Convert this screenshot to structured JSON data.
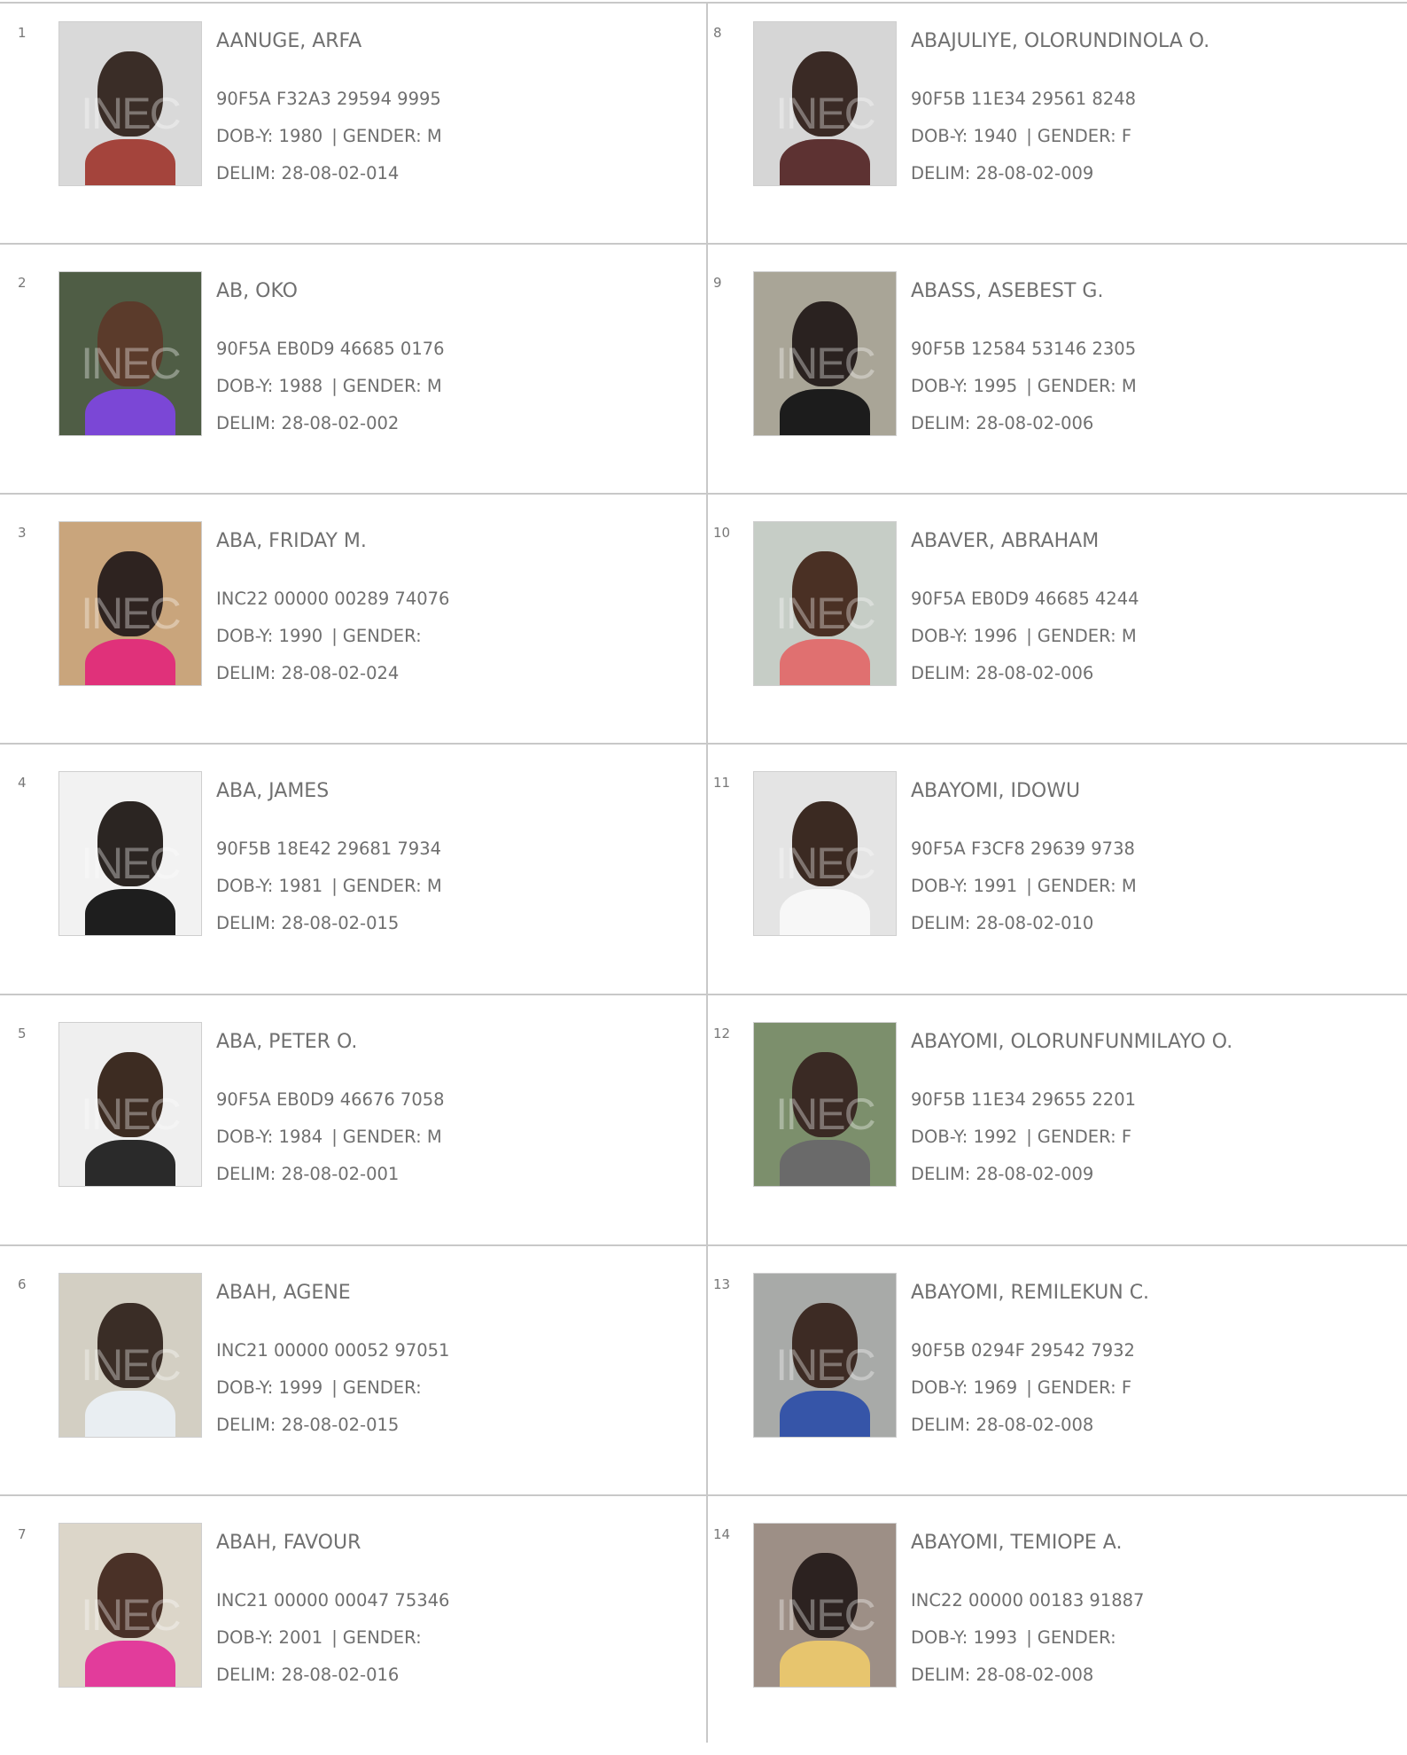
{
  "voters": [
    {
      "index": "1",
      "name": "AANUGE, ARFA",
      "vin": "90F5A F32A3 29594 9995",
      "dob": "DOB-Y: 1980",
      "gender": "GENDER: M",
      "delim": "DELIM: 28-08-02-014",
      "watermark": "INEC",
      "photo_colors": {
        "bg": "#d9d9d9",
        "skin": "#3a2d27",
        "shirt": "#a4443c"
      }
    },
    {
      "index": "2",
      "name": "AB, OKO",
      "vin": "90F5A EB0D9 46685 0176",
      "dob": "DOB-Y: 1988",
      "gender": "GENDER: M",
      "delim": "DELIM: 28-08-02-002",
      "watermark": "INEC",
      "photo_colors": {
        "bg": "#4f5d45",
        "skin": "#5b3b2b",
        "shirt": "#7b47d6"
      }
    },
    {
      "index": "3",
      "name": "ABA, FRIDAY M.",
      "vin": "INC22 00000 00289 74076",
      "dob": "DOB-Y: 1990",
      "gender": "GENDER:",
      "delim": "DELIM: 28-08-02-024",
      "watermark": "INEC",
      "photo_colors": {
        "bg": "#c9a57c",
        "skin": "#2e2320",
        "shirt": "#e0317a"
      }
    },
    {
      "index": "4",
      "name": "ABA, JAMES",
      "vin": "90F5B 18E42 29681 7934",
      "dob": "DOB-Y: 1981",
      "gender": "GENDER: M",
      "delim": "DELIM: 28-08-02-015",
      "watermark": "INEC",
      "photo_colors": {
        "bg": "#f2f2f2",
        "skin": "#2b2522",
        "shirt": "#1e1e1e"
      }
    },
    {
      "index": "5",
      "name": "ABA, PETER O.",
      "vin": "90F5A EB0D9 46676 7058",
      "dob": "DOB-Y: 1984",
      "gender": "GENDER: M",
      "delim": "DELIM: 28-08-02-001",
      "watermark": "INEC",
      "photo_colors": {
        "bg": "#efefef",
        "skin": "#3d2c22",
        "shirt": "#2a2a2a"
      }
    },
    {
      "index": "6",
      "name": "ABAH, AGENE",
      "vin": "INC21 00000 00052 97051",
      "dob": "DOB-Y: 1999",
      "gender": "GENDER:",
      "delim": "DELIM: 28-08-02-015",
      "watermark": "INEC",
      "photo_colors": {
        "bg": "#d3cfc3",
        "skin": "#3a2d26",
        "shirt": "#e9eef2"
      }
    },
    {
      "index": "7",
      "name": "ABAH, FAVOUR",
      "vin": "INC21 00000 00047 75346",
      "dob": "DOB-Y: 2001",
      "gender": "GENDER:",
      "delim": "DELIM: 28-08-02-016",
      "watermark": "INEC",
      "photo_colors": {
        "bg": "#dcd6c9",
        "skin": "#4a3127",
        "shirt": "#e23c9b"
      }
    },
    {
      "index": "8",
      "name": "ABAJULIYE, OLORUNDINOLA O.",
      "vin": "90F5B 11E34 29561 8248",
      "dob": "DOB-Y: 1940",
      "gender": "GENDER: F",
      "delim": "DELIM: 28-08-02-009",
      "watermark": "INEC",
      "photo_colors": {
        "bg": "#d6d6d6",
        "skin": "#3a2a25",
        "shirt": "#5d3232"
      }
    },
    {
      "index": "9",
      "name": "ABASS, ASEBEST G.",
      "vin": "90F5B 12584 53146 2305",
      "dob": "DOB-Y: 1995",
      "gender": "GENDER: M",
      "delim": "DELIM: 28-08-02-006",
      "watermark": "INEC",
      "photo_colors": {
        "bg": "#a9a597",
        "skin": "#2a2220",
        "shirt": "#1c1c1c"
      }
    },
    {
      "index": "10",
      "name": "ABAVER, ABRAHAM",
      "vin": "90F5A EB0D9 46685 4244",
      "dob": "DOB-Y: 1996",
      "gender": "GENDER: M",
      "delim": "DELIM: 28-08-02-006",
      "watermark": "INEC",
      "photo_colors": {
        "bg": "#c6cdc6",
        "skin": "#4a3024",
        "shirt": "#e07070"
      }
    },
    {
      "index": "11",
      "name": "ABAYOMI, IDOWU",
      "vin": "90F5A F3CF8 29639 9738",
      "dob": "DOB-Y: 1991",
      "gender": "GENDER: M",
      "delim": "DELIM: 28-08-02-010",
      "watermark": "INEC",
      "photo_colors": {
        "bg": "#e4e4e4",
        "skin": "#3b2a22",
        "shirt": "#f7f7f7"
      }
    },
    {
      "index": "12",
      "name": "ABAYOMI, OLORUNFUNMILAYO O.",
      "vin": "90F5B 11E34 29655 2201",
      "dob": "DOB-Y: 1992",
      "gender": "GENDER: F",
      "delim": "DELIM: 28-08-02-009",
      "watermark": "INEC",
      "photo_colors": {
        "bg": "#7c8f6c",
        "skin": "#3a2a24",
        "shirt": "#6a6a6a"
      }
    },
    {
      "index": "13",
      "name": "ABAYOMI, REMILEKUN C.",
      "vin": "90F5B 0294F 29542 7932",
      "dob": "DOB-Y: 1969",
      "gender": "GENDER: F",
      "delim": "DELIM: 28-08-02-008",
      "watermark": "INEC",
      "photo_colors": {
        "bg": "#a8aaa8",
        "skin": "#3d2b24",
        "shirt": "#3655a8"
      }
    },
    {
      "index": "14",
      "name": "ABAYOMI, TEMIOPE A.",
      "vin": "INC22 00000 00183 91887",
      "dob": "DOB-Y: 1993",
      "gender": "GENDER:",
      "delim": "DELIM: 28-08-02-008",
      "watermark": "INEC",
      "photo_colors": {
        "bg": "#9d8f86",
        "skin": "#2c2220",
        "shirt": "#e7c56e"
      }
    }
  ],
  "separator": "|"
}
